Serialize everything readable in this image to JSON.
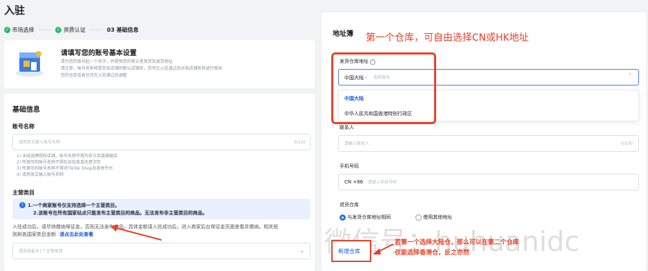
{
  "header": {
    "title": "入驻",
    "steps": [
      {
        "label": "市场选择",
        "done": true
      },
      {
        "label": "资质认证",
        "done": true
      },
      {
        "label": "03 基础信息",
        "done": false
      }
    ]
  },
  "intro": {
    "heading": "请填写您的账号基本设置",
    "lines": [
      "请为您的账号起一个名字，并提供您的首公里发货及退货地址",
      "请注意，账号名称将是您各店铺的默认店铺名，您可在入驻通过后对各店铺名称进行修改",
      "您的仓库信息也可在入驻通过后调整"
    ]
  },
  "basic": {
    "section_title": "基础信息",
    "account_label": "账号名称",
    "account_placeholder": "请用英文输入账号名称",
    "account_counter": "0/120",
    "rules": [
      "1) 未经品牌授权店铺，账号名称不得为官方店或旗舰店",
      "2) 所填写的账号名称不得包含信息或无意字符",
      "3) 所填写的账号名称不得涉TikTok Shop及其他平台",
      "4) 请用英文输入账号名称"
    ],
    "category_label": "主营类目",
    "notice_line1": "1.一个商家账号仅支持选择一个主营类目。",
    "notice_line2": "2.该账号在所有国家站点只能发布主营类目的商品。无法发布非主营类目的商品。",
    "deposit_text1": "入驻成功后，请尽快缴纳保证金，否则无法发布商品。具体金额请入驻成功后，进入商家后台保证金页面查看并缴纳。相关规",
    "deposit_text2": "则和各国家类目金额",
    "deposit_link": "请点击此处查看",
    "category_placeholder": "请选择最多1个主营类目"
  },
  "address": {
    "section_title": "地址簿",
    "annotation_top": "第一个仓库，可自由选择CN或HK地址",
    "warehouse_label": "发货仓库地址",
    "select_value": "中国大陆 -",
    "select_placeholder": "选择省份",
    "options": [
      "中国大陆",
      "中华人民共和国香港特别行政区"
    ],
    "contact_label": "联系人",
    "contact_placeholder": "请输入联系人",
    "contact_counter": "0/100",
    "phone_label": "手机号码",
    "phone_prefix": "CN +86",
    "phone_placeholder": "请输入手机号码",
    "return_label": "退货仓库",
    "radio_same": "与发货仓库地址相同",
    "radio_other": "使用其他地址",
    "add_button": "新增仓库",
    "annotation_bottom1": "若第一个选择大陆仓，那么可以在第二个仓库",
    "annotation_bottom2": "仅能选择香港仓，反之亦然",
    "watermark": "微信号：huhuanidc"
  },
  "colors": {
    "accent": "#e8402a",
    "link": "#1a57d6",
    "success": "#25b864"
  }
}
